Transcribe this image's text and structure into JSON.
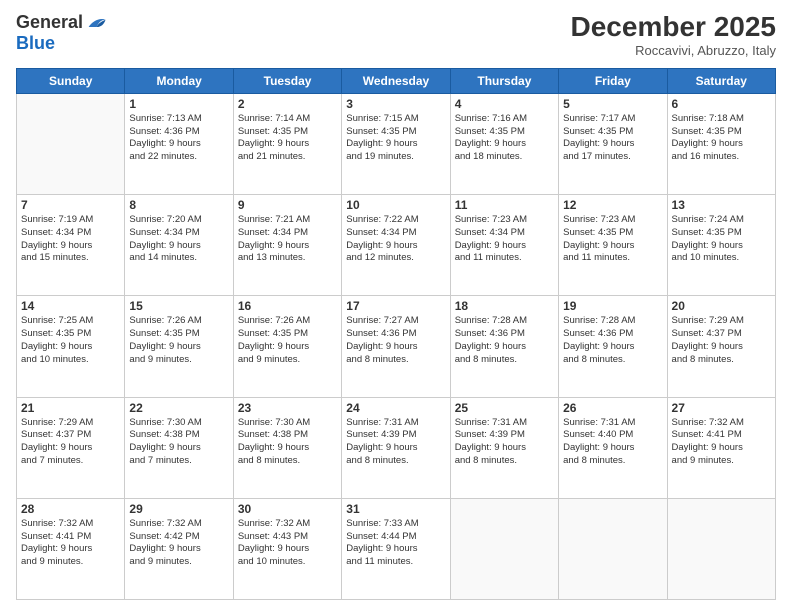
{
  "header": {
    "logo_line1": "General",
    "logo_line2": "Blue",
    "month_title": "December 2025",
    "subtitle": "Roccavivi, Abruzzo, Italy"
  },
  "weekdays": [
    "Sunday",
    "Monday",
    "Tuesday",
    "Wednesday",
    "Thursday",
    "Friday",
    "Saturday"
  ],
  "weeks": [
    [
      {
        "day": "",
        "info": ""
      },
      {
        "day": "1",
        "info": "Sunrise: 7:13 AM\nSunset: 4:36 PM\nDaylight: 9 hours\nand 22 minutes."
      },
      {
        "day": "2",
        "info": "Sunrise: 7:14 AM\nSunset: 4:35 PM\nDaylight: 9 hours\nand 21 minutes."
      },
      {
        "day": "3",
        "info": "Sunrise: 7:15 AM\nSunset: 4:35 PM\nDaylight: 9 hours\nand 19 minutes."
      },
      {
        "day": "4",
        "info": "Sunrise: 7:16 AM\nSunset: 4:35 PM\nDaylight: 9 hours\nand 18 minutes."
      },
      {
        "day": "5",
        "info": "Sunrise: 7:17 AM\nSunset: 4:35 PM\nDaylight: 9 hours\nand 17 minutes."
      },
      {
        "day": "6",
        "info": "Sunrise: 7:18 AM\nSunset: 4:35 PM\nDaylight: 9 hours\nand 16 minutes."
      }
    ],
    [
      {
        "day": "7",
        "info": "Sunrise: 7:19 AM\nSunset: 4:34 PM\nDaylight: 9 hours\nand 15 minutes."
      },
      {
        "day": "8",
        "info": "Sunrise: 7:20 AM\nSunset: 4:34 PM\nDaylight: 9 hours\nand 14 minutes."
      },
      {
        "day": "9",
        "info": "Sunrise: 7:21 AM\nSunset: 4:34 PM\nDaylight: 9 hours\nand 13 minutes."
      },
      {
        "day": "10",
        "info": "Sunrise: 7:22 AM\nSunset: 4:34 PM\nDaylight: 9 hours\nand 12 minutes."
      },
      {
        "day": "11",
        "info": "Sunrise: 7:23 AM\nSunset: 4:34 PM\nDaylight: 9 hours\nand 11 minutes."
      },
      {
        "day": "12",
        "info": "Sunrise: 7:23 AM\nSunset: 4:35 PM\nDaylight: 9 hours\nand 11 minutes."
      },
      {
        "day": "13",
        "info": "Sunrise: 7:24 AM\nSunset: 4:35 PM\nDaylight: 9 hours\nand 10 minutes."
      }
    ],
    [
      {
        "day": "14",
        "info": "Sunrise: 7:25 AM\nSunset: 4:35 PM\nDaylight: 9 hours\nand 10 minutes."
      },
      {
        "day": "15",
        "info": "Sunrise: 7:26 AM\nSunset: 4:35 PM\nDaylight: 9 hours\nand 9 minutes."
      },
      {
        "day": "16",
        "info": "Sunrise: 7:26 AM\nSunset: 4:35 PM\nDaylight: 9 hours\nand 9 minutes."
      },
      {
        "day": "17",
        "info": "Sunrise: 7:27 AM\nSunset: 4:36 PM\nDaylight: 9 hours\nand 8 minutes."
      },
      {
        "day": "18",
        "info": "Sunrise: 7:28 AM\nSunset: 4:36 PM\nDaylight: 9 hours\nand 8 minutes."
      },
      {
        "day": "19",
        "info": "Sunrise: 7:28 AM\nSunset: 4:36 PM\nDaylight: 9 hours\nand 8 minutes."
      },
      {
        "day": "20",
        "info": "Sunrise: 7:29 AM\nSunset: 4:37 PM\nDaylight: 9 hours\nand 8 minutes."
      }
    ],
    [
      {
        "day": "21",
        "info": "Sunrise: 7:29 AM\nSunset: 4:37 PM\nDaylight: 9 hours\nand 7 minutes."
      },
      {
        "day": "22",
        "info": "Sunrise: 7:30 AM\nSunset: 4:38 PM\nDaylight: 9 hours\nand 7 minutes."
      },
      {
        "day": "23",
        "info": "Sunrise: 7:30 AM\nSunset: 4:38 PM\nDaylight: 9 hours\nand 8 minutes."
      },
      {
        "day": "24",
        "info": "Sunrise: 7:31 AM\nSunset: 4:39 PM\nDaylight: 9 hours\nand 8 minutes."
      },
      {
        "day": "25",
        "info": "Sunrise: 7:31 AM\nSunset: 4:39 PM\nDaylight: 9 hours\nand 8 minutes."
      },
      {
        "day": "26",
        "info": "Sunrise: 7:31 AM\nSunset: 4:40 PM\nDaylight: 9 hours\nand 8 minutes."
      },
      {
        "day": "27",
        "info": "Sunrise: 7:32 AM\nSunset: 4:41 PM\nDaylight: 9 hours\nand 9 minutes."
      }
    ],
    [
      {
        "day": "28",
        "info": "Sunrise: 7:32 AM\nSunset: 4:41 PM\nDaylight: 9 hours\nand 9 minutes."
      },
      {
        "day": "29",
        "info": "Sunrise: 7:32 AM\nSunset: 4:42 PM\nDaylight: 9 hours\nand 9 minutes."
      },
      {
        "day": "30",
        "info": "Sunrise: 7:32 AM\nSunset: 4:43 PM\nDaylight: 9 hours\nand 10 minutes."
      },
      {
        "day": "31",
        "info": "Sunrise: 7:33 AM\nSunset: 4:44 PM\nDaylight: 9 hours\nand 11 minutes."
      },
      {
        "day": "",
        "info": ""
      },
      {
        "day": "",
        "info": ""
      },
      {
        "day": "",
        "info": ""
      }
    ]
  ]
}
